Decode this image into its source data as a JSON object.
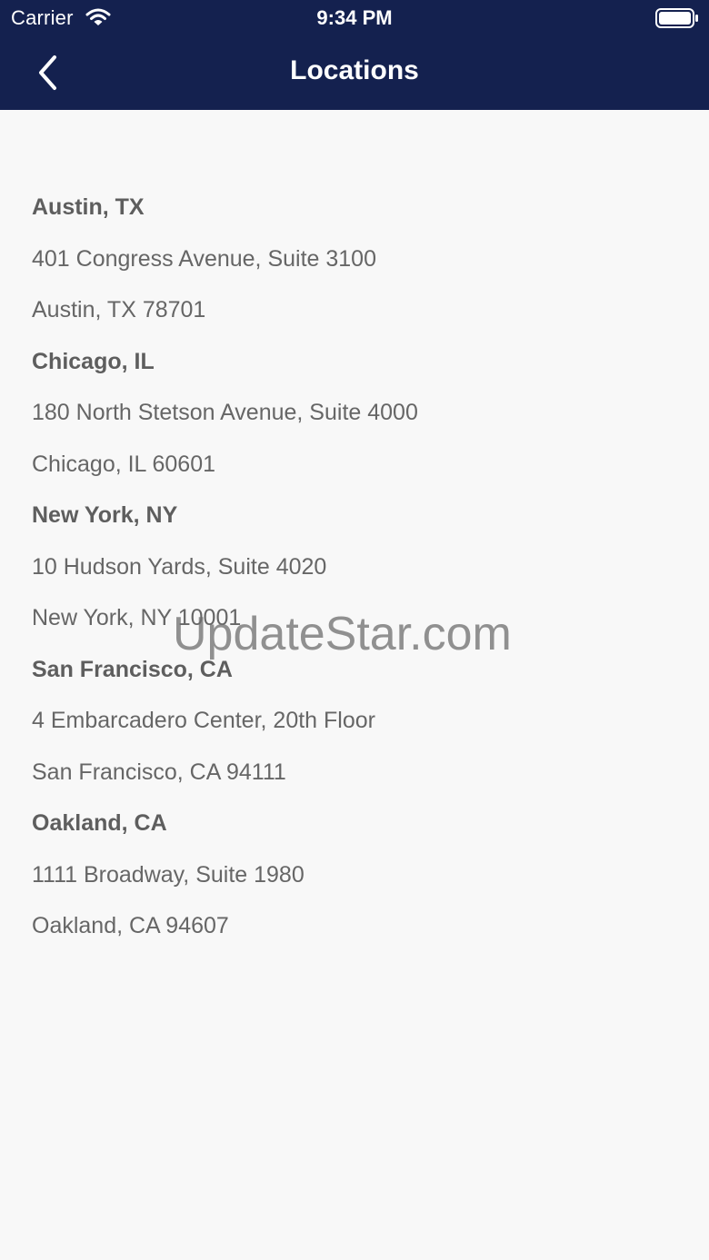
{
  "status_bar": {
    "carrier": "Carrier",
    "time": "9:34 PM",
    "wifi_icon": "wifi-icon",
    "battery_icon": "battery-icon"
  },
  "nav": {
    "title": "Locations",
    "back_icon": "chevron-left-icon",
    "background_color": "#14214f"
  },
  "locations": [
    {
      "city": "Austin, TX",
      "address_line1": "401 Congress Avenue, Suite 3100",
      "address_line2": "Austin, TX 78701"
    },
    {
      "city": "Chicago, IL",
      "address_line1": "180 North Stetson Avenue, Suite 4000",
      "address_line2": "Chicago, IL 60601"
    },
    {
      "city": "New York, NY",
      "address_line1": "10 Hudson Yards, Suite 4020",
      "address_line2": "New York, NY 10001"
    },
    {
      "city": "San Francisco, CA",
      "address_line1": "4 Embarcadero Center, 20th Floor",
      "address_line2": "San Francisco, CA 94111"
    },
    {
      "city": "Oakland, CA",
      "address_line1": "1111 Broadway, Suite 1980",
      "address_line2": "Oakland, CA 94607"
    }
  ],
  "watermark": "UpdateStar.com"
}
